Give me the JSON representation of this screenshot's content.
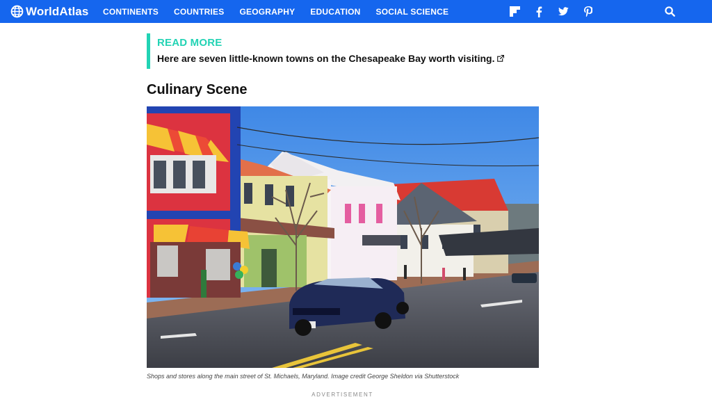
{
  "header": {
    "brand": "WorldAtlas",
    "nav": [
      "CONTINENTS",
      "COUNTRIES",
      "GEOGRAPHY",
      "EDUCATION",
      "SOCIAL SCIENCE"
    ],
    "social_icons": [
      "flipboard-icon",
      "facebook-icon",
      "twitter-icon",
      "pinterest-icon"
    ],
    "search_icon": "search-icon",
    "bar_color": "#1566ee"
  },
  "read_more": {
    "title": "READ MORE",
    "link_text": "Here are seven little-known towns on the Chesapeake Bay worth visiting.",
    "accent_color": "#22d3b4"
  },
  "section": {
    "heading": "Culinary Scene"
  },
  "image": {
    "caption": "Shops and stores along the main street of St. Michaels, Maryland. Image credit George Sheldon via Shutterstock"
  },
  "advertisement_label": "ADVERTISEMENT"
}
